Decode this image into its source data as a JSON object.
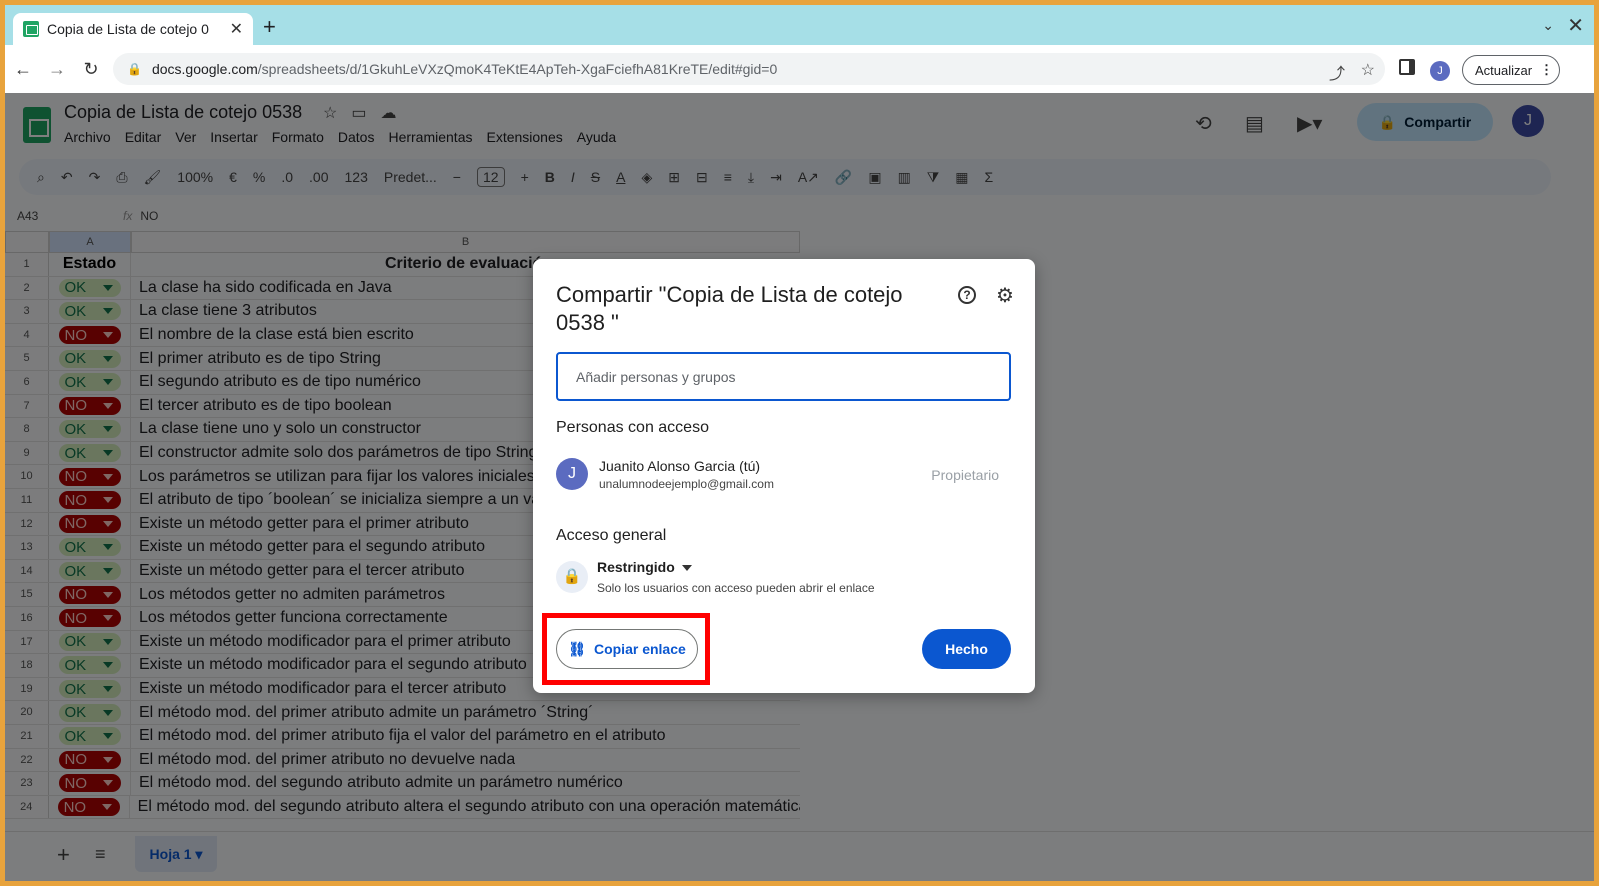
{
  "browser": {
    "tab_title": "Copia de Lista de cotejo 0",
    "url_host": "docs.google.com",
    "url_path": "/spreadsheets/d/1GkuhLeVXzQmoK4TeKtE4ApTeh-XgaFciefhA81KreTE/edit#gid=0",
    "profile_initial": "J",
    "update_label": "Actualizar"
  },
  "sheets": {
    "doc_title": "Copia de Lista de cotejo 0538",
    "menus": [
      "Archivo",
      "Editar",
      "Ver",
      "Insertar",
      "Formato",
      "Datos",
      "Herramientas",
      "Extensiones",
      "Ayuda"
    ],
    "share_label": "Compartir",
    "avatar_initial": "J",
    "zoom": "100%",
    "currency": "€",
    "percent": "%",
    "dec_decrease": ".0",
    "dec_increase": ".00",
    "format_123": "123",
    "font": "Predet...",
    "font_size": "12",
    "cell_ref": "A43",
    "formula": "NO",
    "col_a": "A",
    "col_b": "B",
    "header_estado": "Estado",
    "header_criterio": "Criterio de evaluació",
    "sheet_tab": "Hoja 1",
    "rows": [
      {
        "n": "1"
      },
      {
        "n": "2",
        "status": "OK",
        "text": "La clase ha sido codificada en Java"
      },
      {
        "n": "3",
        "status": "OK",
        "text": "La clase tiene 3 atributos"
      },
      {
        "n": "4",
        "status": "NO",
        "text": "El nombre de la clase está bien escrito"
      },
      {
        "n": "5",
        "status": "OK",
        "text": "El primer atributo es de tipo String"
      },
      {
        "n": "6",
        "status": "OK",
        "text": "El segundo atributo es de tipo numérico"
      },
      {
        "n": "7",
        "status": "NO",
        "text": "El tercer atributo es de tipo boolean"
      },
      {
        "n": "8",
        "status": "OK",
        "text": "La clase tiene uno y solo un constructor"
      },
      {
        "n": "9",
        "status": "OK",
        "text": "El constructor admite solo dos parámetros de tipo String"
      },
      {
        "n": "10",
        "status": "NO",
        "text": "Los parámetros se utilizan para fijar los valores iniciales d"
      },
      {
        "n": "11",
        "status": "NO",
        "text": "El atributo de tipo ´boolean´ se inicializa siempre a un va"
      },
      {
        "n": "12",
        "status": "NO",
        "text": "Existe un método getter para el primer atributo"
      },
      {
        "n": "13",
        "status": "OK",
        "text": "Existe un método getter para el segundo atributo"
      },
      {
        "n": "14",
        "status": "OK",
        "text": "Existe un método getter para el tercer atributo"
      },
      {
        "n": "15",
        "status": "NO",
        "text": "Los métodos getter no admiten parámetros"
      },
      {
        "n": "16",
        "status": "NO",
        "text": "Los métodos getter funciona correctamente"
      },
      {
        "n": "17",
        "status": "OK",
        "text": "Existe un método modificador para el primer atributo"
      },
      {
        "n": "18",
        "status": "OK",
        "text": "Existe un método modificador para el segundo atributo"
      },
      {
        "n": "19",
        "status": "OK",
        "text": "Existe un método modificador para el tercer atributo"
      },
      {
        "n": "20",
        "status": "OK",
        "text": "El método mod. del primer atributo admite un parámetro ´String´"
      },
      {
        "n": "21",
        "status": "OK",
        "text": "El método mod. del primer atributo fija el valor del parámetro en el atributo"
      },
      {
        "n": "22",
        "status": "NO",
        "text": "El método mod. del primer atributo no devuelve nada"
      },
      {
        "n": "23",
        "status": "NO",
        "text": "El método mod. del segundo atributo admite un parámetro numérico"
      },
      {
        "n": "24",
        "status": "NO",
        "text": "El método mod. del segundo atributo altera el segundo atributo con una operación matemática"
      }
    ]
  },
  "dialog": {
    "title": "Compartir \"Copia de Lista de cotejo 0538 \"",
    "help_glyph": "?",
    "add_placeholder": "Añadir personas y grupos",
    "people_heading": "Personas con acceso",
    "person_initial": "J",
    "person_name": "Juanito Alonso Garcia (tú)",
    "person_email": "unalumnodeejemplo@gmail.com",
    "person_role": "Propietario",
    "general_heading": "Acceso general",
    "access_value": "Restringido",
    "access_desc": "Solo los usuarios con acceso pueden abrir el enlace",
    "copy_link": "Copiar enlace",
    "done": "Hecho"
  },
  "colors": {
    "accent": "#0b57d0",
    "ok_bg": "#d4edbc",
    "no_bg": "#b10202",
    "highlight": "#ff0000"
  }
}
